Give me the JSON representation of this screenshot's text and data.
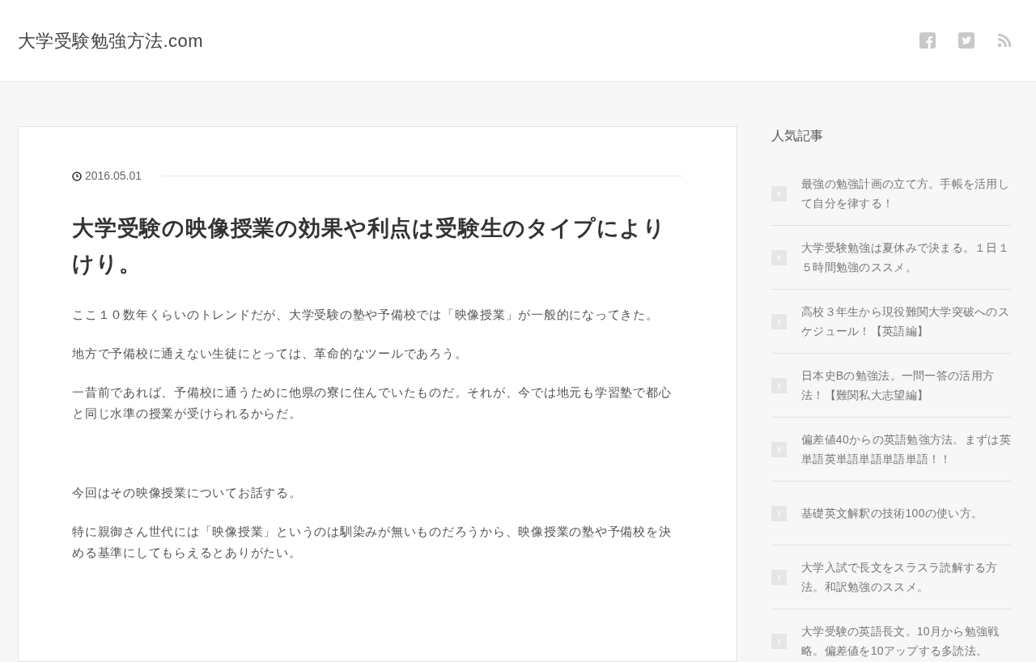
{
  "site_title": "大学受験勉強方法.com",
  "article": {
    "date": "2016.05.01",
    "title": "大学受験の映像授業の効果や利点は受験生のタイプによりけり。",
    "sections": [
      [
        "ここ１０数年くらいのトレンドだが、大学受験の塾や予備校では「映像授業」が一般的になってきた。",
        "地方で予備校に通えない生徒にとっては、革命的なツールであろう。",
        "一昔前であれば、予備校に通うために他県の寮に住んでいたものだ。それが、今では地元も学習塾で都心と同じ水準の授業が受けられるからだ。"
      ],
      [
        "今回はその映像授業についてお話する。",
        "特に親御さん世代には「映像授業」というのは馴染みが無いものだろうから、映像授業の塾や予備校を決める基準にしてもらえるとありがたい。"
      ]
    ]
  },
  "sidebar": {
    "heading": "人気記事",
    "items": [
      "最強の勉強計画の立て方。手帳を活用して自分を律する！",
      "大学受験勉強は夏休みで決まる。１日１５時間勉強のススメ。",
      "高校３年生から現役難関大学突破へのスケジュール！【英語編】",
      "日本史Bの勉強法。一問一答の活用方法！【難関私大志望編】",
      "偏差値40からの英語勉強方法。まずは英単語英単語単語単語単語！！",
      "基礎英文解釈の技術100の使い方。",
      "大学入試で長文をスラスラ読解する方法。和訳勉強のススメ。",
      "大学受験の英語長文。10月から勉強戦略。偏差値を10アップする多読法。"
    ]
  }
}
